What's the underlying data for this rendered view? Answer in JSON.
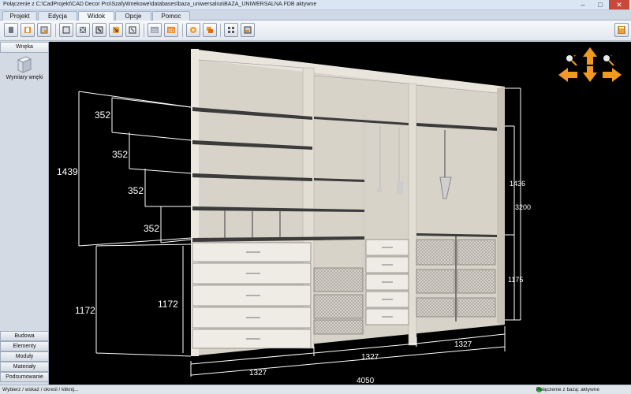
{
  "window": {
    "title": "Połączenie z C:\\CadProjekt\\CAD Decor Pro\\SzafyWnekowe\\databases\\baza_uniwersalna\\BAZA_UNIWERSALNA.FDB aktywne"
  },
  "menu_tabs": [
    {
      "label": "Projekt"
    },
    {
      "label": "Edycja"
    },
    {
      "label": "Widok",
      "active": true
    },
    {
      "label": "Opcje"
    },
    {
      "label": "Pomoc"
    }
  ],
  "toolbar": {
    "icons": [
      "door-icon",
      "cabinet-icon",
      "panel-icon",
      "box-icon",
      "drawer-icon",
      "shelf-icon",
      "arrow-frame-icon",
      "frame-icon",
      "2d-view-icon",
      "3d-view-icon",
      "settings-icon",
      "layers-icon",
      "grid-icon",
      "export-icon",
      "calculator-icon"
    ]
  },
  "sidebar": {
    "header": "Wnęka",
    "item_label": "Wymiary wnęki",
    "bottom_buttons": [
      "Budowa",
      "Elementy",
      "Moduły",
      "Materiały",
      "Podsumowanie"
    ]
  },
  "viewport": {
    "dimensions_left": {
      "total": "1439",
      "segments": [
        "352",
        "352",
        "352",
        "352"
      ],
      "lower_outer": "1172",
      "lower_inner": "1172"
    },
    "dimensions_right": {
      "upper": "1436",
      "total": "3200",
      "lower": "1175"
    },
    "dimensions_bottom": {
      "sections": [
        "1327",
        "1327",
        "1327"
      ],
      "total": "4050"
    },
    "nav_icons": [
      "zoom-in-icon",
      "zoom-out-icon",
      "arrow-up-icon",
      "arrow-down-icon",
      "arrow-left-icon",
      "arrow-right-icon"
    ],
    "accent_color": "#f29a1f"
  },
  "statusbar": {
    "hint": "Wybierz / wskaż / określ / kliknij...",
    "connection": "Połączenie z bazą: aktywne"
  }
}
